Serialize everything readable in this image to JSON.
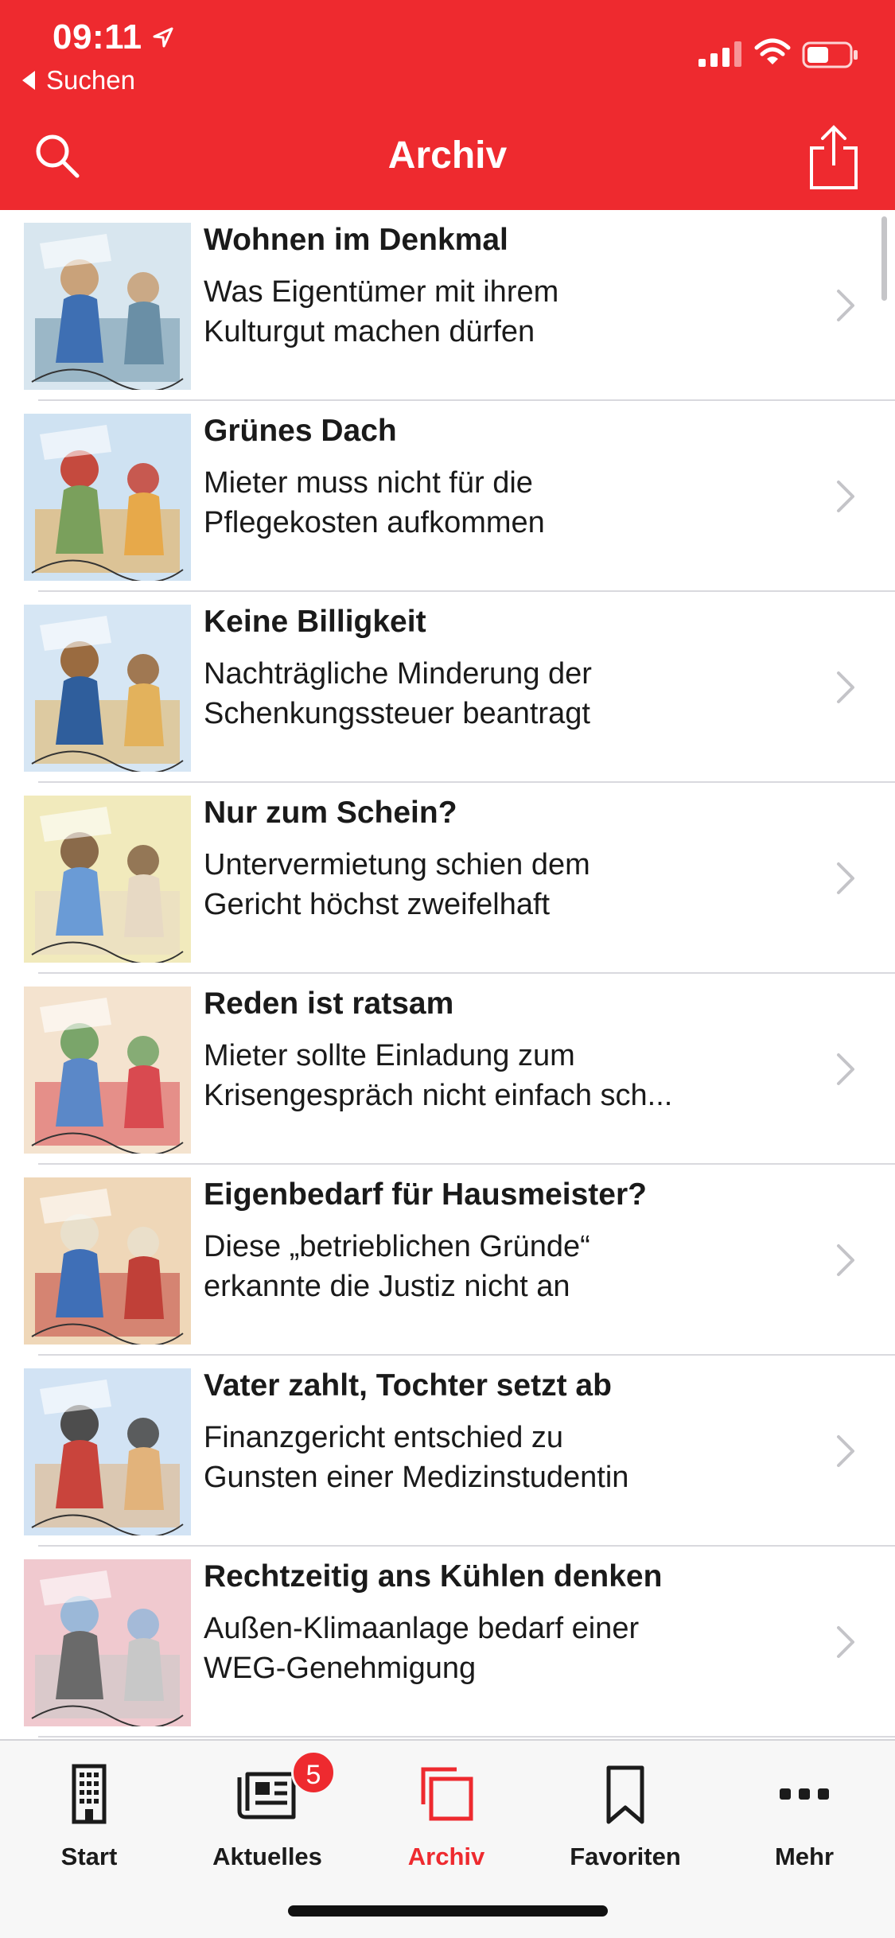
{
  "status": {
    "time": "09:11",
    "back_label": "Suchen"
  },
  "header": {
    "title": "Archiv"
  },
  "articles": [
    {
      "title": "Wohnen im Denkmal",
      "line1": "Was Eigentümer mit ihrem",
      "line2": "Kulturgut machen dürfen",
      "thumb_colors": [
        "#d8e6ef",
        "#6a8fa6",
        "#3e6fb3",
        "#c9a27a"
      ]
    },
    {
      "title": "Grünes Dach",
      "line1": "Mieter muss nicht für die",
      "line2": "Pflegekosten aufkommen",
      "thumb_colors": [
        "#cfe2f2",
        "#e7a94a",
        "#7aa05c",
        "#c54a3e"
      ]
    },
    {
      "title": "Keine Billigkeit",
      "line1": "Nachträgliche Minderung der",
      "line2": "Schenkungssteuer beantragt",
      "thumb_colors": [
        "#d6e6f4",
        "#e3b25c",
        "#2f5e9c",
        "#9a6b40"
      ]
    },
    {
      "title": "Nur zum Schein?",
      "line1": "Untervermietung schien dem",
      "line2": "Gericht höchst zweifelhaft",
      "thumb_colors": [
        "#f1eabc",
        "#e7d9c4",
        "#6a9bd6",
        "#8a6a4a"
      ]
    },
    {
      "title": "Reden ist ratsam",
      "line1": "Mieter sollte Einladung zum",
      "line2": "Krisengespräch nicht einfach sch...",
      "thumb_colors": [
        "#f4e3cf",
        "#d94a50",
        "#5b88c8",
        "#7aa56a"
      ]
    },
    {
      "title": "Eigenbedarf für Hausmeister?",
      "line1": "Diese „betrieblichen Gründe“",
      "line2": "erkannte die Justiz nicht an",
      "thumb_colors": [
        "#efd7b8",
        "#c04038",
        "#3f6fb7",
        "#e9e0cc"
      ]
    },
    {
      "title": "Vater zahlt, Tochter setzt ab",
      "line1": "Finanzgericht entschied zu",
      "line2": "Gunsten einer Medizinstudentin",
      "thumb_colors": [
        "#d2e3f4",
        "#e2b37b",
        "#c9443c",
        "#4d4d4d"
      ]
    },
    {
      "title": "Rechtzeitig ans Kühlen denken",
      "line1": "Außen-Klimaanlage bedarf einer",
      "line2": "WEG-Genehmigung",
      "thumb_colors": [
        "#f0c9cf",
        "#c8c8c8",
        "#6a6a6a",
        "#9bb8d8"
      ]
    }
  ],
  "tabs": [
    {
      "label": "Start",
      "icon": "building-icon"
    },
    {
      "label": "Aktuelles",
      "icon": "newspaper-icon",
      "badge": "5"
    },
    {
      "label": "Archiv",
      "icon": "archive-icon",
      "active": true
    },
    {
      "label": "Favoriten",
      "icon": "bookmark-icon"
    },
    {
      "label": "Mehr",
      "icon": "more-icon"
    }
  ],
  "colors": {
    "accent": "#ee2a2f",
    "tabbar_bg": "#f7f7f7"
  }
}
